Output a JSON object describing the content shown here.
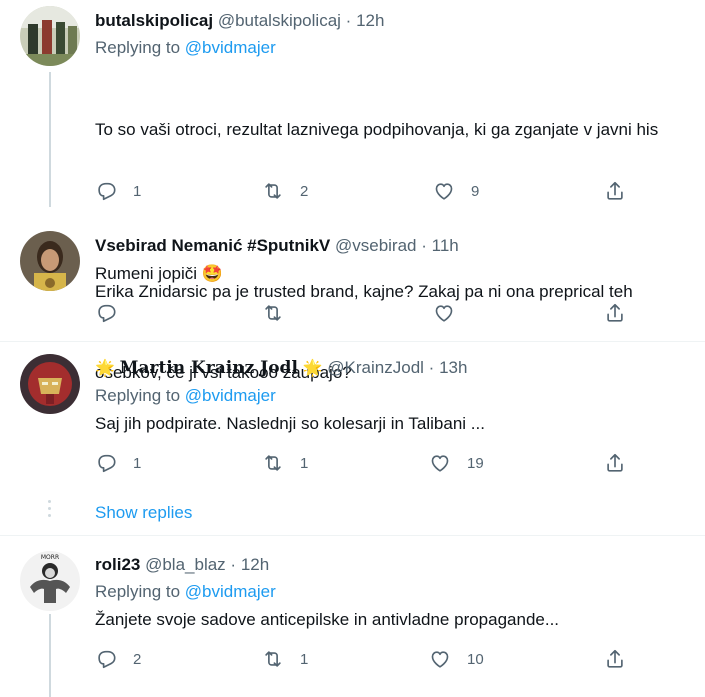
{
  "tweets": [
    {
      "name": "butalskipolicaj",
      "handle": "@butalskipolicaj",
      "separator": "·",
      "time": "12h",
      "replying_prefix": "Replying to",
      "replying_to": "@bvidmajer",
      "text_line1": "To so vaši otroci, rezultat laznivega podpihovanja, ki ga zganjate v javni his",
      "text_line2": "Erika Znidarsic pa je trusted brand, kajne? Zakaj pa ni ona preprical teh",
      "text_line3": "osebkov, če ji vsi takooo zaupajo?",
      "replies": "1",
      "retweets": "2",
      "likes": "9"
    },
    {
      "name": "Vsebirad Nemanić #SputnikV",
      "handle": "@vsebirad",
      "separator": "·",
      "time": "11h",
      "text": "Rumeni jopiči 🤩"
    },
    {
      "name_prefix_emoji": "🌟",
      "name": "Martin Krainz Jodl",
      "name_suffix_emoji": "🌟",
      "handle": "@KrainzJodl",
      "separator": "·",
      "time": "13h",
      "replying_prefix": "Replying to",
      "replying_to": "@bvidmajer",
      "text": "Saj jih podpirate. Naslednji so kolesarji in Talibani ...",
      "replies": "1",
      "retweets": "1",
      "likes": "19",
      "show_replies": "Show replies"
    },
    {
      "name": "roli23",
      "handle": "@bla_blaz",
      "separator": "·",
      "time": "12h",
      "replying_prefix": "Replying to",
      "replying_to": "@bvidmajer",
      "text": "Žanjete svoje sadove anticepilske in antivladne propagande...",
      "replies": "2",
      "retweets": "1",
      "likes": "10"
    }
  ],
  "icons": {
    "reply": "reply-icon",
    "retweet": "retweet-icon",
    "like": "heart-icon",
    "share": "share-icon"
  },
  "colors": {
    "link": "#1d9bf0",
    "secondary_text": "#536471",
    "divider": "#eff3f4",
    "thread_line": "#cfd9de"
  }
}
